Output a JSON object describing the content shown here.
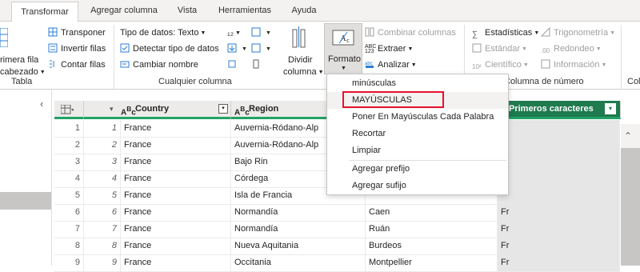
{
  "tabs": [
    "Transformar",
    "Agregar columna",
    "Vista",
    "Herramientas",
    "Ayuda"
  ],
  "ribbon": {
    "tabla": {
      "label": "Tabla",
      "primera_fila": "rimera fila",
      "encabezado": "cabezado",
      "transponer": "Transponer",
      "invertir_filas": "Invertir filas",
      "contar_filas": "Contar filas"
    },
    "cualquier_columna": {
      "label": "Cualquier columna",
      "tipo_datos": "Tipo de datos: Texto",
      "detectar_tipo": "Detectar tipo de datos",
      "cambiar_nombre": "Cambiar nombre",
      "dividir": "Dividir",
      "columna": "columna",
      "formato": "Formato"
    },
    "texto": {
      "combinar_columnas": "Combinar columnas",
      "extraer": "Extraer",
      "analizar": "Analizar"
    },
    "numero": {
      "label": "Columna de número",
      "estadisticas": "Estadísticas",
      "estandar": "Estándar",
      "cientifico": "Científico",
      "trigonometria": "Trigonometría",
      "redondeo": "Redondeo",
      "informacion": "Información",
      "col_cut": "Col"
    }
  },
  "grid": {
    "headers": {
      "country": "Country",
      "region": "Region",
      "col4": "Primeros caracteres"
    },
    "rows": [
      {
        "idx": "1",
        "n": "1",
        "country": "France",
        "region": "Auvernia-Ródano-Alp",
        "city": "",
        "first": ""
      },
      {
        "idx": "2",
        "n": "2",
        "country": "France",
        "region": "Auvernia-Ródano-Alp",
        "city": "",
        "first": ""
      },
      {
        "idx": "3",
        "n": "3",
        "country": "France",
        "region": "Bajo Rin",
        "city": "",
        "first": ""
      },
      {
        "idx": "4",
        "n": "4",
        "country": "France",
        "region": "Córdega",
        "city": "",
        "first": ""
      },
      {
        "idx": "5",
        "n": "5",
        "country": "France",
        "region": "Isla de Francia",
        "city": "",
        "first": ""
      },
      {
        "idx": "6",
        "n": "6",
        "country": "France",
        "region": "Normandía",
        "city": "Caen",
        "first": "Fr"
      },
      {
        "idx": "7",
        "n": "7",
        "country": "France",
        "region": "Normandía",
        "city": "Ruán",
        "first": "Fr"
      },
      {
        "idx": "8",
        "n": "8",
        "country": "France",
        "region": "Nueva Aquitania",
        "city": "Burdeos",
        "first": "Fr"
      },
      {
        "idx": "9",
        "n": "9",
        "country": "France",
        "region": "Occitania",
        "city": "Montpellier",
        "first": "Fr"
      }
    ]
  },
  "menu": {
    "items": [
      "minúsculas",
      "MAYÚSCULAS",
      "Poner En Mayúsculas Cada Palabra",
      "Recortar",
      "Limpiar",
      "Agregar prefijo",
      "Agregar sufijo"
    ]
  },
  "colors": {
    "accent": "#21a366",
    "highlight": "#e8112d",
    "header_bg": "#edebe9",
    "selected_col_bg": "#e6e6e6"
  }
}
